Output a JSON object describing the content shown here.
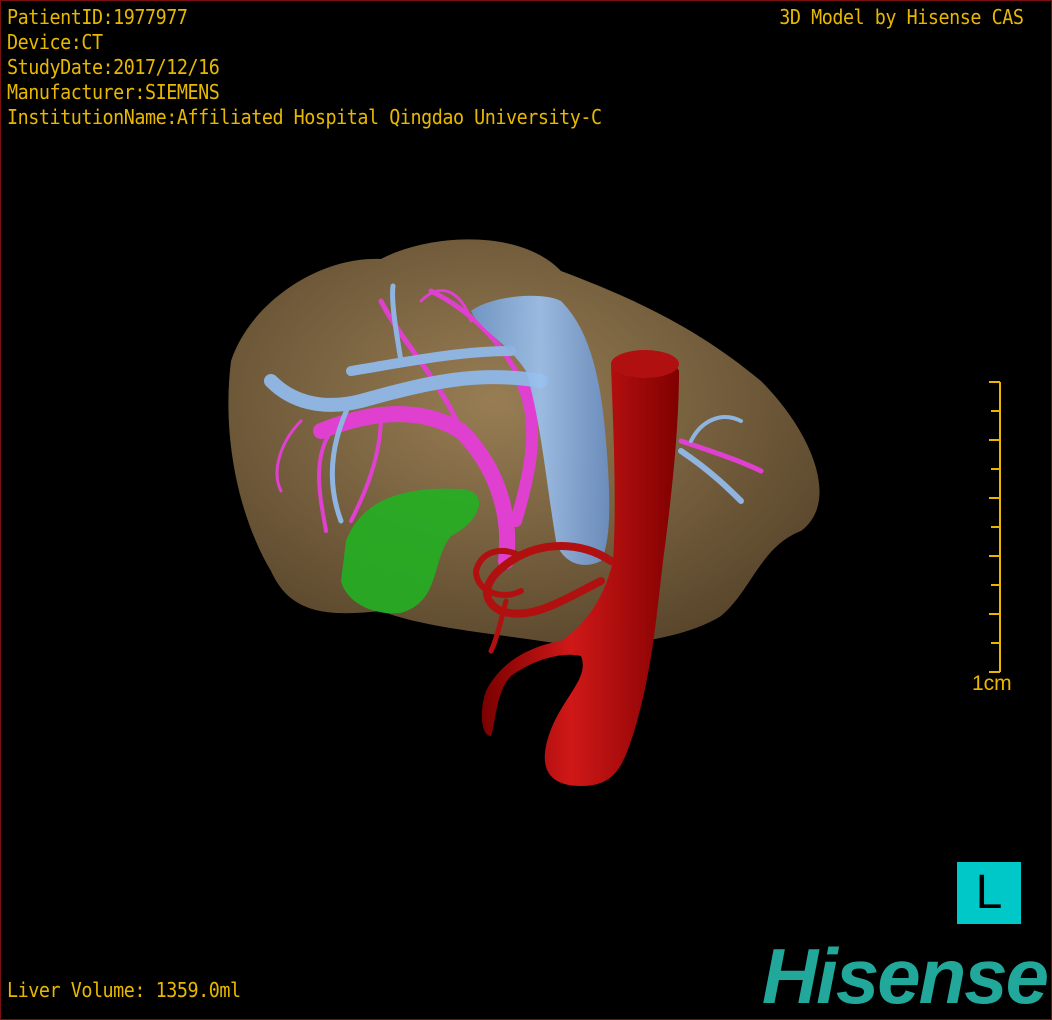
{
  "overlay": {
    "patient_id": "PatientID:1977977",
    "device": "Device:CT",
    "study_date": "StudyDate:2017/12/16",
    "manufacturer": "Manufacturer:SIEMENS",
    "institution": "InstitutionName:Affiliated Hospital Qingdao University-C",
    "model_credit": "3D Model by Hisense CAS",
    "liver_volume": "Liver Volume: 1359.0ml"
  },
  "scale_bar": {
    "label": "1cm",
    "ticks": 10
  },
  "orientation_marker": {
    "label": "L",
    "color": "#00c8c8"
  },
  "logo": {
    "text": "Hisense",
    "color": "#21a89a"
  },
  "colors": {
    "text": "#e8b800",
    "liver": "#8a7048",
    "hepatic_vein": "#8fb4e0",
    "portal_vein": "#e040d0",
    "gallbladder": "#22b022",
    "artery": "#c01010",
    "border": "#7a1010"
  }
}
